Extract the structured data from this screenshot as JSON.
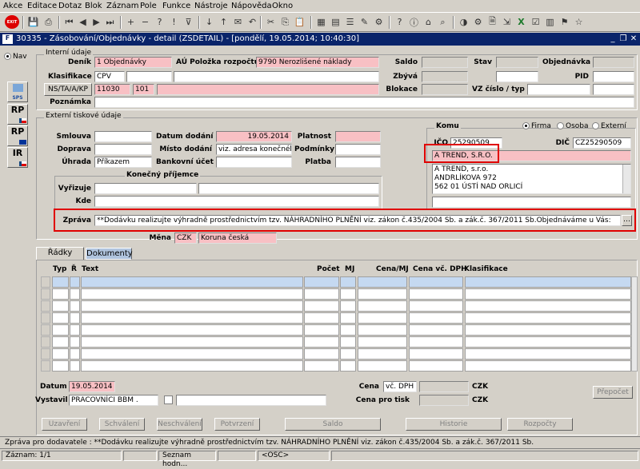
{
  "menu": [
    "Akce",
    "Editace",
    "Dotaz",
    "Blok",
    "Záznam",
    "Pole",
    "Funkce",
    "Nástroje",
    "Nápověda",
    "Okno"
  ],
  "toolbar": {
    "exit_label": "EXIT"
  },
  "window": {
    "title": "30335 - Zásobování/Objednávky - detail (ZSDETAIL) - [pondělí, 19.05.2014; 10:40:30]"
  },
  "nav_label": "Nav",
  "side_buttons": [
    "SPS",
    "RP",
    "RP",
    "IR"
  ],
  "internal": {
    "section": "Interní údaje",
    "denik_label": "Deník",
    "denik": "1 Objednávky",
    "au_label": "AÚ Položka rozpočtu",
    "au": "9790 Nerozlišené náklady",
    "saldo_label": "Saldo",
    "stav_label": "Stav",
    "objednavka_label": "Objednávka",
    "klasifikace_label": "Klasifikace",
    "klasifikace": "CPV",
    "zbyva_label": "Zbývá",
    "pid_label": "PID",
    "ns_button": "NS/TA/A/KP",
    "ns_1": "11030",
    "ns_2": "101",
    "blokace_label": "Blokace",
    "vz_label": "VZ číslo / typ",
    "poznamka_label": "Poznámka"
  },
  "external": {
    "section": "Externí tiskové údaje",
    "smlouva_label": "Smlouva",
    "doprava_label": "Doprava",
    "uhrada_label": "Úhrada",
    "uhrada": "Příkazem",
    "datum_dodani_label": "Datum dodání",
    "datum_dodani": "19.05.2014",
    "misto_dodani_label": "Místo dodání",
    "misto_dodani": "viz. adresa konečného p",
    "bankovni_ucet_label": "Bankovní účet",
    "platnost_label": "Platnost",
    "podminky_label": "Podmínky",
    "platba_label": "Platba",
    "konecny_title": "Konečný příjemce",
    "vyrizuje_label": "Vyřizuje",
    "kde_label": "Kde",
    "zprava_label": "Zpráva",
    "zprava": "**Dodávku realizujte výhradně prostřednictvím tzv. NÁHRADNÍHO PLNĚNÍ viz. zákon č.435/2004 Sb. a zák.č. 367/2011 Sb.Objednáváme u Vás:",
    "mena_label": "Měna",
    "mena_code": "CZK",
    "mena_name": "Koruna česká"
  },
  "komu": {
    "title": "Komu",
    "radio_firma": "Firma",
    "radio_osoba": "Osoba",
    "radio_externi": "Externí",
    "ico_label": "IČO",
    "ico": "25290509",
    "dic_label": "DIČ",
    "dic": "CZ25290509",
    "name": "A TREND, S.R.O.",
    "address": [
      "A TREND, s.r.o.",
      "ANDRLÍKOVA 972",
      "562 01  ÚSTÍ NAD ORLICÍ"
    ]
  },
  "tabs": [
    "Řádky",
    "Dokumenty"
  ],
  "grid": {
    "columns": [
      "Typ",
      "Ř",
      "Text",
      "Počet",
      "MJ",
      "Cena/MJ",
      "Cena vč. DPH",
      "Klasifikace"
    ]
  },
  "footer": {
    "datum_label": "Datum",
    "datum": "19.05.2014",
    "vystavil_label": "Vystavil",
    "vystavil": "PRACOVNÍCI BBM .",
    "cena_label": "Cena",
    "cena_type": "vč. DPH",
    "cena_currency": "CZK",
    "cena_tisk_label": "Cena pro tisk",
    "cena_tisk_currency": "CZK",
    "prepocet": "Přepočet"
  },
  "actions": [
    "Uzavření",
    "Schválení",
    "Neschválení",
    "Potvrzení",
    "Saldo",
    "Historie",
    "Rozpočty"
  ],
  "status": {
    "message": "Zpráva pro dodavatele : **Dodávku realizujte výhradně prostřednictvím tzv. NÁHRADNÍHO PLNĚNÍ viz. zákon č.435/2004 Sb. a zák.č. 367/2011 Sb.",
    "record": "Záznam: 1/1",
    "seznam": "Seznam hodn...",
    "osc": "<OSC>"
  }
}
